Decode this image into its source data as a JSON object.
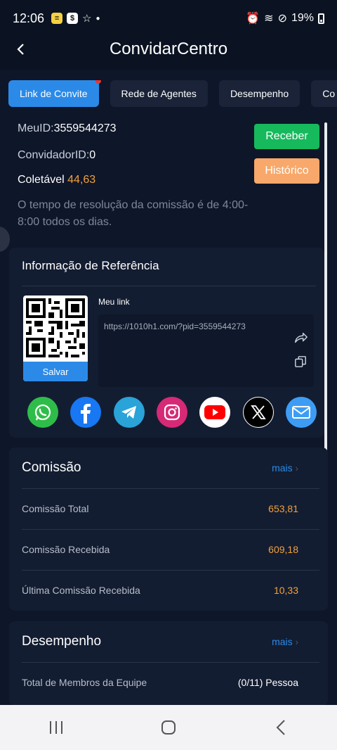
{
  "status_bar": {
    "time": "12:06",
    "battery": "19%"
  },
  "header": {
    "title": "ConvidarCentro"
  },
  "tabs": [
    {
      "label": "Link de Convite",
      "active": true
    },
    {
      "label": "Rede de Agentes",
      "active": false
    },
    {
      "label": "Desempenho",
      "active": false
    },
    {
      "label": "Co",
      "active": false
    }
  ],
  "account": {
    "meuid_label": "MeuID:",
    "meuid_value": "3559544273",
    "convidador_label": "ConvidadorID:",
    "convidador_value": "0",
    "coletavel_label": "Coletável",
    "coletavel_value": "44,63",
    "receive_button": "Receber",
    "history_button": "Histórico",
    "resolution_note": "O tempo de resolução da comissão é de 4:00-8:00 todos os dias."
  },
  "referral": {
    "title": "Informação de Referência",
    "save_button": "Salvar",
    "my_link_label": "Meu link",
    "link": "https://1010h1.com/?pid=3559544273",
    "socials": [
      "whatsapp-icon",
      "facebook-icon",
      "telegram-icon",
      "instagram-icon",
      "youtube-icon",
      "x-icon",
      "email-icon"
    ]
  },
  "commission": {
    "title": "Comissão",
    "more": "mais",
    "rows": [
      {
        "label": "Comissão Total",
        "value": "653,81"
      },
      {
        "label": "Comissão Recebida",
        "value": "609,18"
      },
      {
        "label": "Última Comissão Recebida",
        "value": "10,33"
      }
    ]
  },
  "performance": {
    "title": "Desempenho",
    "more": "mais",
    "rows": [
      {
        "label": "Total de Membros da Equipe",
        "value": "(0/11) Pessoa"
      }
    ]
  },
  "colors": {
    "accent": "#2b8ae8",
    "receive": "#16b95c",
    "history": "#f7a86a",
    "value_orange": "#f2a03d",
    "background": "#0e1629"
  }
}
